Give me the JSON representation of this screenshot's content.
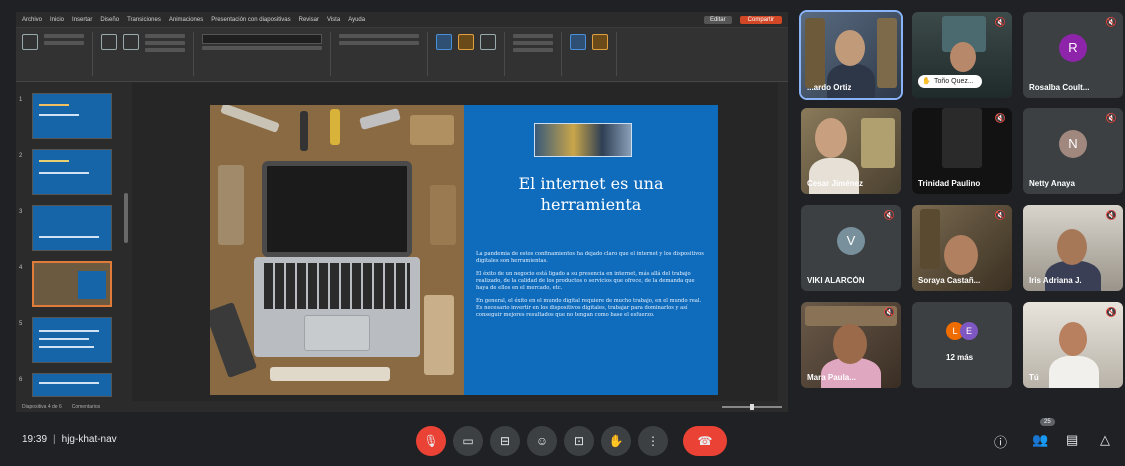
{
  "ppt": {
    "menu": [
      "Archivo",
      "Inicio",
      "Insertar",
      "Diseño",
      "Transiciones",
      "Animaciones",
      "Presentación con diapositivas",
      "Revisar",
      "Vista",
      "Ayuda"
    ],
    "edit_label": "Editar",
    "share_label": "Compartir",
    "status_left": "Diapositiva 4 de 6",
    "status_mid": "Comentarios",
    "zoom_label": ""
  },
  "slide": {
    "title": "El internet es una herramienta",
    "body": [
      "La pandemia de estos confinamientos ha dejado claro que el internet y los dispositivos digitales son herramientas.",
      "El éxito de un negocio está ligado a su presencia en internet, más allá del trabajo realizado, de la calidad de los productos o servicios que ofrece, de la demanda que haya de ellos en el mercado, etc.",
      "En general, el éxito en el mundo digital requiere de mucho trabajo, en el mundo real. Es necesario invertir en los dispositivos digitales, trabajar para dominarlos y así conseguir mejores resultados que no tengan como base el esfuerzo."
    ],
    "thumb_numbers": [
      "1",
      "2",
      "3",
      "4",
      "5",
      "6"
    ]
  },
  "participants": [
    {
      "name": "...ardo Ortiz",
      "muted": false,
      "active": true
    },
    {
      "name": "Toño Quez...",
      "muted": true,
      "hand_raised": true
    },
    {
      "name": "Rosalba Coult...",
      "muted": true,
      "initial": "R",
      "color": "#8e24aa"
    },
    {
      "name": "Cesar Jiménez",
      "muted": false
    },
    {
      "name": "Trinidad Paulino",
      "muted": true
    },
    {
      "name": "Netty Anaya",
      "muted": true,
      "initial": "N",
      "color": "#a1887f"
    },
    {
      "name": "VIKI ALARCÓN",
      "muted": true,
      "initial": "V",
      "color": "#78909c"
    },
    {
      "name": "Soraya Castañ...",
      "muted": true
    },
    {
      "name": "Iris Adriana J.",
      "muted": true
    },
    {
      "name": "Mara Paula...",
      "muted": true
    },
    {
      "name": "12 más",
      "avatars": [
        {
          "initial": "L",
          "color": "#ef6c00"
        },
        {
          "initial": "E",
          "color": "#7e57c2"
        }
      ]
    },
    {
      "name": "Tú",
      "muted": true
    }
  ],
  "meeting": {
    "time": "19:39",
    "code": "hjg-khat-nav",
    "participant_badge": "25"
  },
  "icons": {
    "mic_off": "mic-off-icon",
    "camera": "camera-icon",
    "captions": "captions-icon",
    "emoji": "emoji-icon",
    "present": "present-icon",
    "raise_hand": "raise-hand-icon",
    "more": "more-options-icon",
    "hangup": "hang-up-icon",
    "info": "info-icon",
    "people": "people-icon",
    "chat": "chat-icon",
    "activities": "activities-icon"
  }
}
